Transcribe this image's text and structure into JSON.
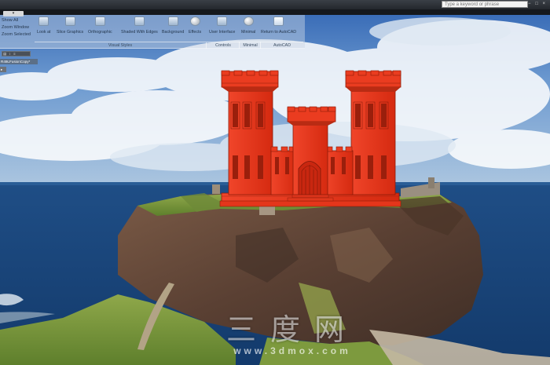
{
  "window": {
    "tab_label": "▾",
    "search_placeholder": "Type a keyword or phrase",
    "controls": "− □ ×"
  },
  "ribbon": {
    "left_items": [
      "Show All",
      "Zoom Window",
      "Zoom Selected"
    ],
    "buttons": [
      {
        "label": "Look at",
        "icon": "look-at-icon"
      },
      {
        "label": "Slice Graphics",
        "icon": "slice-graphics-icon"
      },
      {
        "label": "Orthographic",
        "icon": "orthographic-icon"
      },
      {
        "label": "Shaded With Edges",
        "icon": "shaded-edges-icon"
      },
      {
        "label": "Background",
        "icon": "background-icon"
      },
      {
        "label": "Effects",
        "icon": "effects-icon"
      },
      {
        "label": "User Interface",
        "icon": "user-interface-icon"
      },
      {
        "label": "Minimal",
        "icon": "minimal-icon"
      },
      {
        "label": "Return to AutoCAD",
        "icon": "return-autocad-icon"
      }
    ],
    "groups": [
      "Visual Styles",
      "Controls",
      "Minimal",
      "AutoCAD"
    ]
  },
  "browser": {
    "toolbar": "▤ ↕ ≡",
    "item": "R49LFusionCopy*",
    "item2": "▸"
  },
  "watermark": {
    "main": "三度网",
    "sub": "www.3dmox.com"
  },
  "colors": {
    "castle": "#e3341a",
    "castle_dark": "#9a1f0c",
    "sky": "#4f86c6",
    "sea": "#1d4f87"
  }
}
